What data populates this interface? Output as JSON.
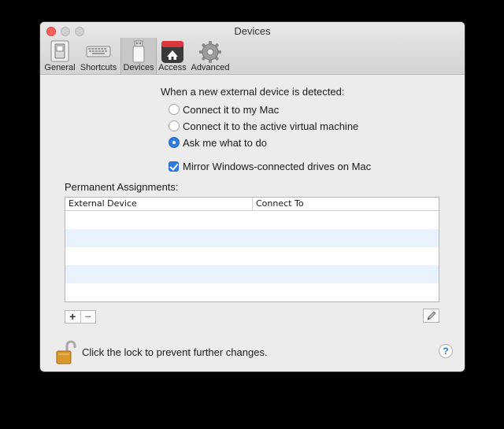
{
  "window": {
    "title": "Devices"
  },
  "toolbar": {
    "items": [
      {
        "label": "General",
        "icon": "switch-icon"
      },
      {
        "label": "Shortcuts",
        "icon": "keyboard-icon"
      },
      {
        "label": "Devices",
        "icon": "usb-drive-icon",
        "selected": true
      },
      {
        "label": "Access",
        "icon": "parallels-home-icon"
      },
      {
        "label": "Advanced",
        "icon": "gear-icon"
      }
    ]
  },
  "devices": {
    "heading": "When a new external device is detected:",
    "options": [
      {
        "label": "Connect it to my Mac",
        "selected": false
      },
      {
        "label": "Connect it to the active virtual machine",
        "selected": false
      },
      {
        "label": "Ask me what to do",
        "selected": true
      }
    ],
    "mirror_label": "Mirror Windows-connected drives on Mac",
    "mirror_checked": true,
    "permanent_label": "Permanent Assignments:",
    "columns": [
      "External Device",
      "Connect To"
    ],
    "add_label": "+",
    "remove_label": "−"
  },
  "footer": {
    "lock_text": "Click the lock to prevent further changes.",
    "help_label": "?"
  },
  "colors": {
    "accent": "#2f7de1",
    "row_alt": "#e9f1fc",
    "close": "#fc605c"
  }
}
